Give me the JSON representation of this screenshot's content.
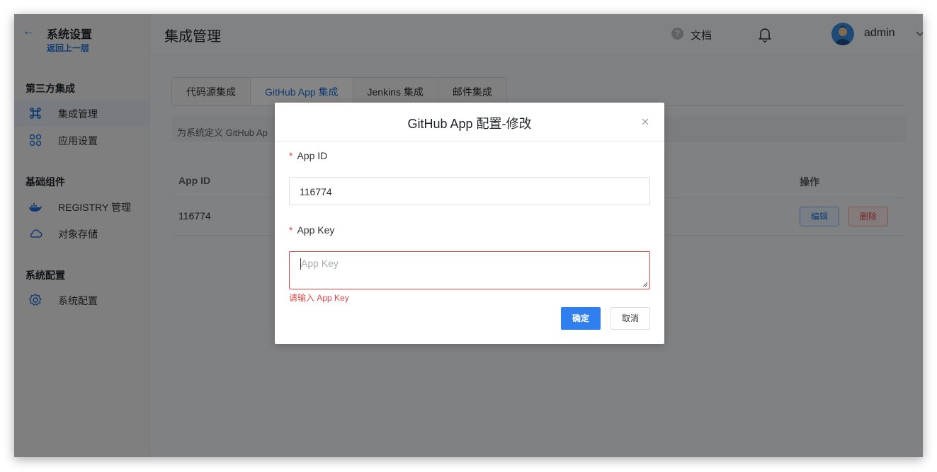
{
  "sidebar": {
    "back_icon": "arrow-left-icon",
    "title": "系统设置",
    "subtitle": "返回上一层",
    "groups": [
      {
        "label": "第三方集成"
      },
      {
        "label": "基础组件"
      },
      {
        "label": "系统配置"
      }
    ],
    "items": [
      {
        "label": "集成管理",
        "icon": "command-icon",
        "active": true
      },
      {
        "label": "应用设置",
        "icon": "apps-grid-icon",
        "active": false
      },
      {
        "label": "REGISTRY 管理",
        "icon": "docker-whale-icon",
        "active": false
      },
      {
        "label": "对象存储",
        "icon": "cloud-icon",
        "active": false
      },
      {
        "label": "系统配置",
        "icon": "settings-gear-icon",
        "active": false
      }
    ]
  },
  "header": {
    "title": "集成管理",
    "help_icon": "help-circle-icon",
    "docs_label": "文档",
    "bell_icon": "bell-icon",
    "user_name": "admin",
    "menu_icon": "chevron-down-icon"
  },
  "tabs": [
    {
      "label": "代码源集成",
      "active": false
    },
    {
      "label": "GitHub App 集成",
      "active": true
    },
    {
      "label": "Jenkins 集成",
      "active": false
    },
    {
      "label": "邮件集成",
      "active": false
    }
  ],
  "info_bar": {
    "text": "为系统定义 GitHub Ap"
  },
  "table": {
    "columns": [
      "App ID",
      "操作"
    ],
    "rows": [
      {
        "app_id": "116774",
        "actions": [
          "编辑",
          "删除"
        ]
      }
    ]
  },
  "modal": {
    "title": "GitHub App 配置-修改",
    "close_icon": "close-icon",
    "fields": [
      {
        "label": "App ID",
        "required": true,
        "value": "116774"
      },
      {
        "label": "App Key",
        "required": true,
        "value": "",
        "placeholder": "App Key",
        "error": "请输入 App Key"
      }
    ],
    "confirm_label": "确定",
    "cancel_label": "取消"
  },
  "colors": {
    "accent": "#2f7fef",
    "link": "#1e6fd9",
    "danger": "#e04848",
    "overlay": "rgba(0,0,0,0.48)"
  }
}
